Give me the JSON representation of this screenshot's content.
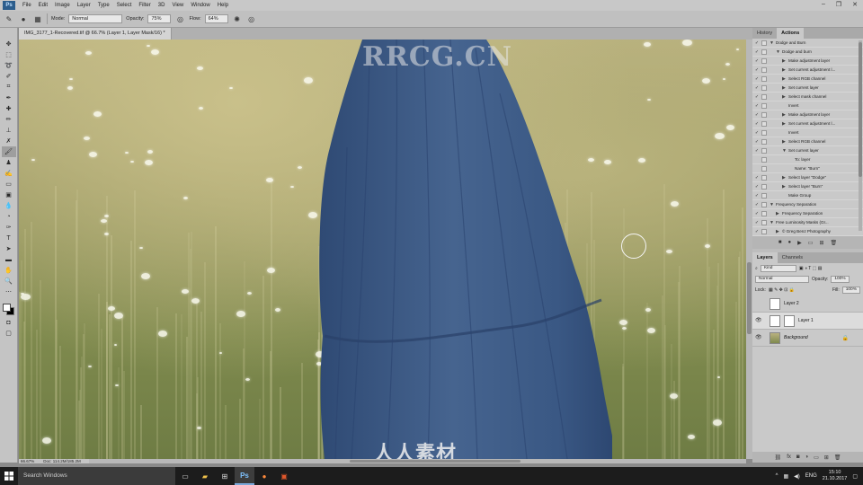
{
  "app": {
    "logo": "Ps",
    "menu": [
      "File",
      "Edit",
      "Image",
      "Layer",
      "Type",
      "Select",
      "Filter",
      "3D",
      "View",
      "Window",
      "Help"
    ],
    "window_controls": [
      "–",
      "❐",
      "✕"
    ]
  },
  "options_bar": {
    "mode_label": "Mode:",
    "mode_value": "Normal",
    "opacity_label": "Opacity:",
    "opacity_value": "75%",
    "flow_label": "Flow:",
    "flow_value": "64%"
  },
  "document": {
    "tab_title": "IMG_3177_1-Recovered.tif @ 66.7% (Layer 1, Layer Mask/16) *",
    "zoom": "66.67%",
    "doc_size": "Doc: 114.2M/185.2M"
  },
  "watermarks": {
    "top": "RRCG.CN",
    "bottom": "人人素材"
  },
  "panels": {
    "top_tabs": [
      "History",
      "Actions"
    ],
    "actions": [
      {
        "level": 0,
        "text": "Dodge and Burn",
        "check": "✓",
        "expand": "▼"
      },
      {
        "level": 1,
        "text": "Dodge and burn",
        "check": "✓",
        "expand": "▼"
      },
      {
        "level": 2,
        "text": "Make adjustment layer",
        "check": "✓",
        "expand": "▶"
      },
      {
        "level": 2,
        "text": "Set current adjustment l...",
        "check": "✓",
        "expand": "▶"
      },
      {
        "level": 2,
        "text": "Select RGB channel",
        "check": "✓",
        "expand": "▶"
      },
      {
        "level": 2,
        "text": "Set current layer",
        "check": "✓",
        "expand": "▶"
      },
      {
        "level": 2,
        "text": "Select mask channel",
        "check": "✓",
        "expand": "▶"
      },
      {
        "level": 2,
        "text": "Invert",
        "check": "✓",
        "expand": ""
      },
      {
        "level": 2,
        "text": "Make adjustment layer",
        "check": "✓",
        "expand": "▶"
      },
      {
        "level": 2,
        "text": "Set current adjustment l...",
        "check": "✓",
        "expand": "▶"
      },
      {
        "level": 2,
        "text": "Invert",
        "check": "✓",
        "expand": ""
      },
      {
        "level": 2,
        "text": "Select RGB channel",
        "check": "✓",
        "expand": "▶"
      },
      {
        "level": 2,
        "text": "Set current layer",
        "check": "✓",
        "expand": "▼"
      },
      {
        "level": 3,
        "text": "To: layer",
        "check": "",
        "expand": ""
      },
      {
        "level": 3,
        "text": "Name: \"Burn\"",
        "check": "",
        "expand": ""
      },
      {
        "level": 2,
        "text": "Select layer \"Dodge\"",
        "check": "✓",
        "expand": "▶"
      },
      {
        "level": 2,
        "text": "Select layer \"Burn\"",
        "check": "✓",
        "expand": "▶"
      },
      {
        "level": 2,
        "text": "Make Group",
        "check": "✓",
        "expand": ""
      },
      {
        "level": 0,
        "text": "Frequency Separation",
        "check": "✓",
        "expand": "▼"
      },
      {
        "level": 1,
        "text": "Frequency Separation",
        "check": "✓",
        "expand": "▶"
      },
      {
        "level": 0,
        "text": "Free Luminosity Masks (Gr...",
        "check": "✓",
        "expand": "▼"
      },
      {
        "level": 1,
        "text": "© Greg Benz Photography",
        "check": "✓",
        "expand": "▶"
      }
    ],
    "layers_tabs": [
      "Layers",
      "Channels"
    ],
    "kind_label": "Kind",
    "blend_mode": "Normal",
    "opacity_label": "Opacity:",
    "opacity_value": "100%",
    "lock_label": "Lock:",
    "fill_label": "Fill:",
    "fill_value": "100%",
    "layers": [
      {
        "name": "Layer 2",
        "visible": false,
        "selected": false,
        "mask": false,
        "locked": false
      },
      {
        "name": "Layer 1",
        "visible": true,
        "selected": true,
        "mask": true,
        "locked": false
      },
      {
        "name": "Background",
        "visible": true,
        "selected": false,
        "mask": false,
        "locked": true
      }
    ]
  },
  "taskbar": {
    "search_placeholder": "Search Windows",
    "language": "ENG",
    "time": "15:10",
    "date": "21.10.2017"
  }
}
